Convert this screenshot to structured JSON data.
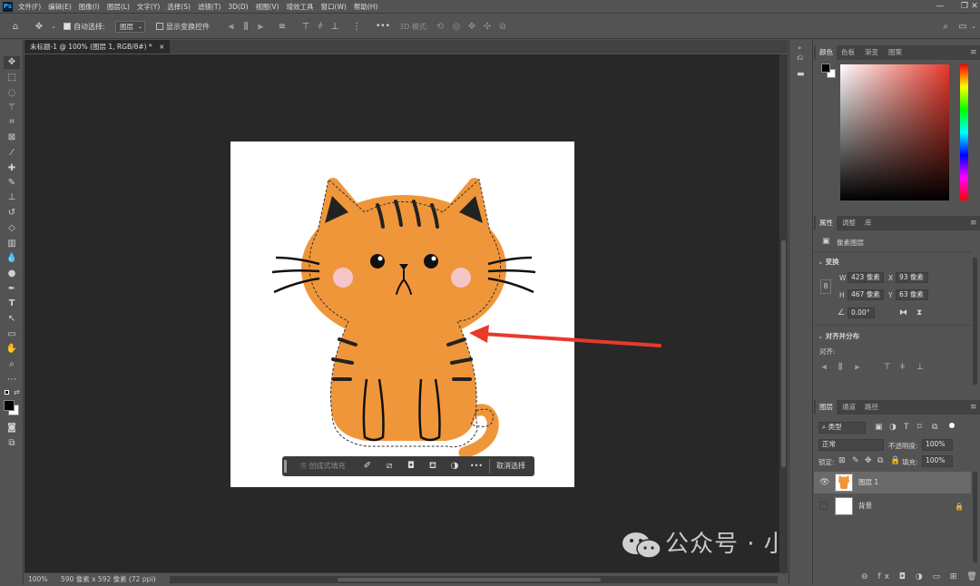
{
  "app": {
    "logo": "Ps"
  },
  "menu": [
    "文件(F)",
    "编辑(E)",
    "图像(I)",
    "图层(L)",
    "文字(Y)",
    "选择(S)",
    "滤镜(T)",
    "3D(D)",
    "视图(V)",
    "增效工具",
    "窗口(W)",
    "帮助(H)"
  ],
  "options": {
    "auto_select_label": "自动选择:",
    "auto_select_value": "图层",
    "show_transform_label": "显示变换控件",
    "mode_3d_label": "3D 模式:",
    "more": "•••"
  },
  "document": {
    "tab_title": "未标题-1 @ 100% (图层 1, RGB/8#) *",
    "close": "×"
  },
  "status": {
    "zoom": "100%",
    "doc_info": "590 像素 x 592 像素 (72 ppi)",
    "arrow": "›"
  },
  "context_taskbar": {
    "generative_fill": "创成式填充",
    "more": "•••",
    "deselect": "取消选择"
  },
  "watermark": "公众号 · 小白电脑技术",
  "color_panel": {
    "tabs": [
      "颜色",
      "色板",
      "渐变",
      "图案"
    ]
  },
  "properties_panel": {
    "tabs": [
      "属性",
      "调整",
      "库"
    ],
    "layer_type": "像素图层",
    "transform_title": "变换",
    "w_label": "W",
    "w_value": "423 像素",
    "x_label": "X",
    "x_value": "93 像素",
    "h_label": "H",
    "h_value": "467 像素",
    "y_label": "Y",
    "y_value": "63 像素",
    "angle_value": "0.00°",
    "align_title": "对齐并分布",
    "align_label": "对齐:"
  },
  "layers_panel": {
    "tabs": [
      "图层",
      "通道",
      "路径"
    ],
    "filter_type": "类型",
    "blend_mode": "正常",
    "opacity_label": "不透明度:",
    "opacity_value": "100%",
    "lock_label": "锁定:",
    "fill_label": "填充:",
    "fill_value": "100%",
    "layers": [
      {
        "name": "图层 1",
        "selected": true
      },
      {
        "name": "背景",
        "selected": false
      }
    ],
    "footer_icons": "⊖ fx ◘ ◑ ▭ ⊞ 🗑"
  },
  "colors": {
    "accent_red": "#e8392b",
    "cat_orange": "#f0963a",
    "foreground": "#000000",
    "background": "#ffffff"
  }
}
